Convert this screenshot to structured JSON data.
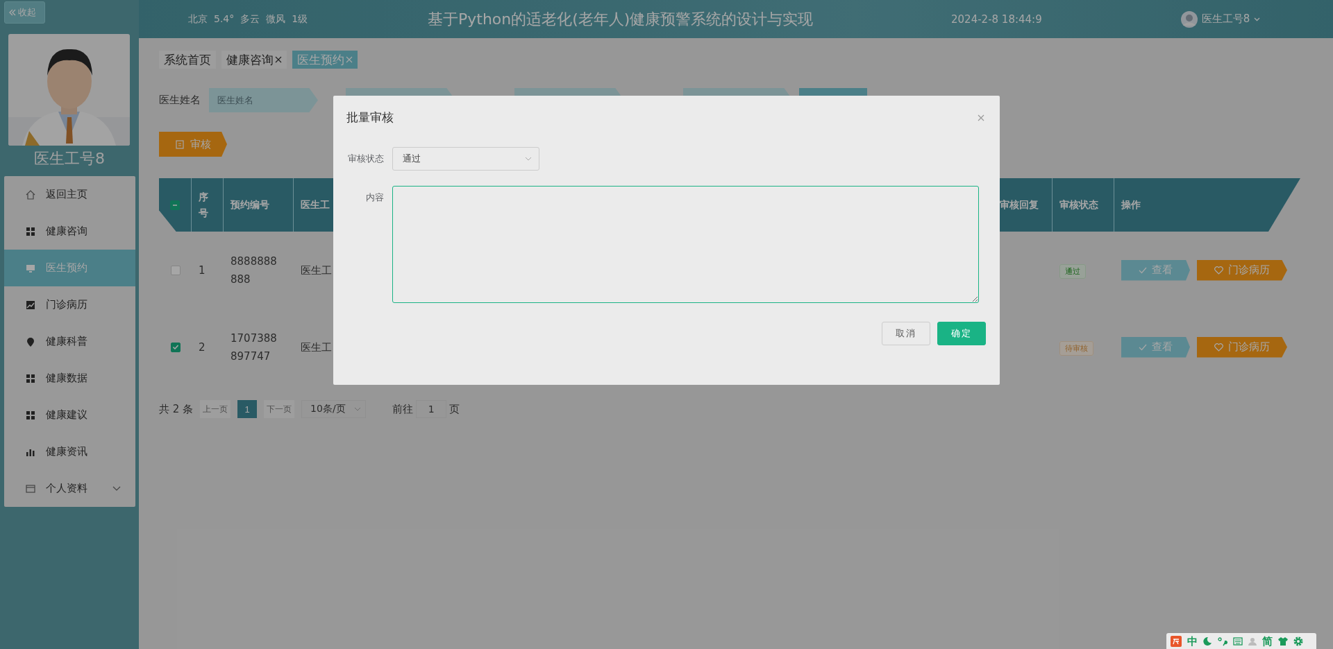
{
  "sidebar": {
    "collapse_button": "收起",
    "user_name": "医生工号8",
    "menu": [
      {
        "label": "返回主页",
        "kind": "link",
        "selected": false
      },
      {
        "label": "健康咨询",
        "kind": "link",
        "selected": false
      },
      {
        "label": "医生预约",
        "kind": "link",
        "selected": true
      },
      {
        "label": "门诊病历",
        "kind": "link",
        "selected": false
      },
      {
        "label": "健康科普",
        "kind": "link",
        "selected": false
      },
      {
        "label": "健康数据",
        "kind": "link",
        "selected": false
      },
      {
        "label": "健康建议",
        "kind": "link",
        "selected": false
      },
      {
        "label": "健康资讯",
        "kind": "link",
        "selected": false
      },
      {
        "label": "个人资料",
        "kind": "submenu",
        "selected": false
      }
    ]
  },
  "header": {
    "weather": [
      "北京",
      "5.4°",
      "多云",
      "微风",
      "1级"
    ],
    "title": "基于Python的适老化(老年人)健康预警系统的设计与实现",
    "datetime": "2024-2-8 18:44:9",
    "user": "医生工号8"
  },
  "tabs": [
    {
      "label": "系统首页",
      "closable": false,
      "selected": false
    },
    {
      "label": "健康咨询",
      "closable": true,
      "selected": false
    },
    {
      "label": "医生预约",
      "closable": true,
      "selected": true
    }
  ],
  "search": {
    "fields": [
      {
        "label": "医生姓名",
        "placeholder": "医生姓名"
      }
    ]
  },
  "toolbar": {
    "review_button": "审核"
  },
  "table": {
    "select_all": {
      "indeterminate": true
    },
    "columns": [
      "序号",
      "预约编号",
      "医生工",
      "审核回复",
      "审核状态",
      "操作"
    ],
    "rows": [
      {
        "checked": false,
        "index": "1",
        "number": "8888888888",
        "doctor": "医生工",
        "status": {
          "label": "通过",
          "kind": "pass"
        },
        "actions": [
          "查看",
          "门诊病历"
        ]
      },
      {
        "checked": true,
        "index": "2",
        "number": "1707388897747",
        "doctor": "医生工",
        "status": {
          "label": "待审核",
          "kind": "pending"
        },
        "actions": [
          "查看",
          "门诊病历"
        ]
      }
    ]
  },
  "pagination": {
    "total": "共 2 条",
    "prev": "上一页",
    "pages": [
      {
        "label": "1",
        "selected": true
      }
    ],
    "next": "下一页",
    "page_size": "10条/页",
    "goto_label": "前往",
    "goto_value": "1",
    "page_unit": "页"
  },
  "dialog": {
    "title": "批量审核",
    "fields": [
      {
        "kind": "select",
        "label": "审核状态",
        "value": "通过"
      },
      {
        "kind": "textarea",
        "label": "内容",
        "focused": true
      }
    ],
    "buttons": [
      {
        "label": "取消",
        "kind": "default"
      },
      {
        "label": "确定",
        "kind": "primary"
      }
    ]
  },
  "ime_bar": {
    "mode": "中",
    "script": "简"
  }
}
